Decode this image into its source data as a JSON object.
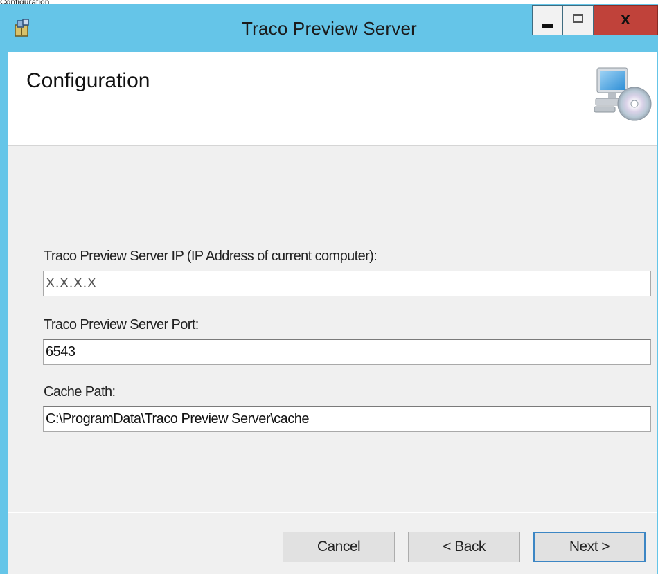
{
  "caption": "Configuration",
  "window": {
    "title": "Traco Preview Server",
    "controls": {
      "minimize": "minimize",
      "maximize": "maximize",
      "close": "x"
    },
    "app_icon": "installer-icon"
  },
  "banner": {
    "title": "Configuration",
    "icon": "computer-cd-icon"
  },
  "fields": {
    "ip": {
      "label": "Traco Preview Server IP (IP Address of current computer):",
      "value": "X.X.X.X"
    },
    "port": {
      "label": "Traco Preview Server Port:",
      "value": "6543"
    },
    "cache": {
      "label": "Cache Path:",
      "value": "C:\\ProgramData\\Traco Preview Server\\cache"
    }
  },
  "buttons": {
    "cancel": "Cancel",
    "back": "< Back",
    "next": "Next >"
  },
  "colors": {
    "titlebar": "#65c5e8",
    "close_button": "#c0423a",
    "dialog_background": "#f0f0f0",
    "default_button_border": "#3c86c4"
  }
}
